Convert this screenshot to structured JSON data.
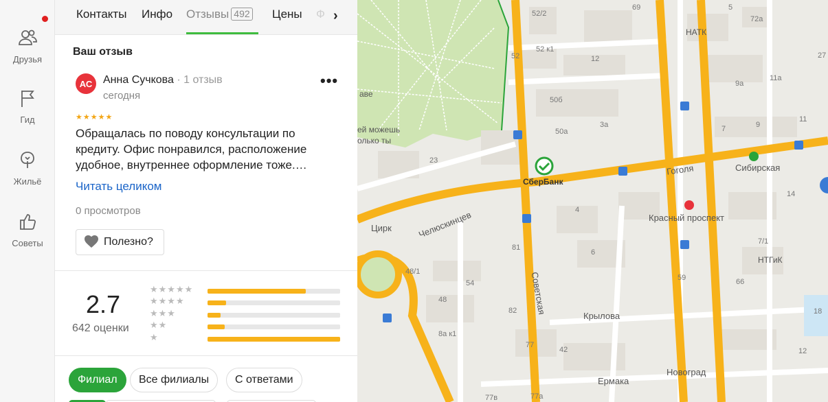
{
  "rail": {
    "items": [
      {
        "label": "Друзья",
        "icon": "friends-icon"
      },
      {
        "label": "Гид",
        "icon": "flag-icon"
      },
      {
        "label": "Жильё",
        "icon": "house-icon"
      },
      {
        "label": "Советы",
        "icon": "thumb-up-icon"
      }
    ],
    "notification_color": "#e02020"
  },
  "tabs": {
    "contacts": "Контакты",
    "info": "Инфо",
    "reviews": "Отзывы",
    "reviews_count": "492",
    "prices": "Цены",
    "faded": "Ф",
    "next_arrow": "›"
  },
  "my_review": {
    "heading": "Ваш отзыв",
    "avatar_initials": "АС",
    "author": "Анна Сучкова",
    "author_reviews": "1 отзыв",
    "date": "сегодня",
    "menu": "•••",
    "stars": "★★★★★",
    "text": "Обращалась по поводу консультации по кредиту. Офис понравился, расположение удобное, внутреннее оформление тоже.…",
    "read_more": "Читать целиком",
    "views": "0 просмотров",
    "useful_label": "Полезно?"
  },
  "rating": {
    "value": "2.7",
    "count_label": "642 оценки",
    "distribution": [
      {
        "stars": "★★★★★",
        "fraction": 0.74
      },
      {
        "stars": "★★★★",
        "fraction": 0.14
      },
      {
        "stars": "★★★",
        "fraction": 0.1
      },
      {
        "stars": "★★",
        "fraction": 0.13
      },
      {
        "stars": "★",
        "fraction": 1.0
      }
    ],
    "bar_color": "#f7b21a"
  },
  "filters": {
    "branch": "Филиал",
    "all_branches": "Все филиалы",
    "with_answers": "С ответами"
  },
  "map": {
    "streets": {
      "gogolya": "Гоголя",
      "chelyuskintsev": "Челюскинцев",
      "sovetskaya": "Советская",
      "krasny": "Красный проспект",
      "krylova": "Крылова",
      "ermaka": "Ермака"
    },
    "places": {
      "sberbank": "СберБанк",
      "sibirskaya": "Сибирская",
      "cirk": "Цирк",
      "natk": "НАТК",
      "ntgik": "НТГиК",
      "novograd": "Новоград",
      "park1": "ей можешь",
      "park2": "олько ты",
      "park3": "аве"
    },
    "numbers": [
      "52/2",
      "52 к1",
      "52",
      "12",
      "69",
      "5",
      "72а",
      "27",
      "11а",
      "9а",
      "50б",
      "3а",
      "50а",
      "7",
      "9",
      "11",
      "23",
      "4",
      "14",
      "6",
      "7/1",
      "81",
      "48/1",
      "54",
      "48",
      "8а к1",
      "82",
      "77",
      "42",
      "59",
      "66",
      "18",
      "77в",
      "77а",
      "12"
    ],
    "metro_color": "#e8333b",
    "sibir_color": "#2ba43a"
  }
}
